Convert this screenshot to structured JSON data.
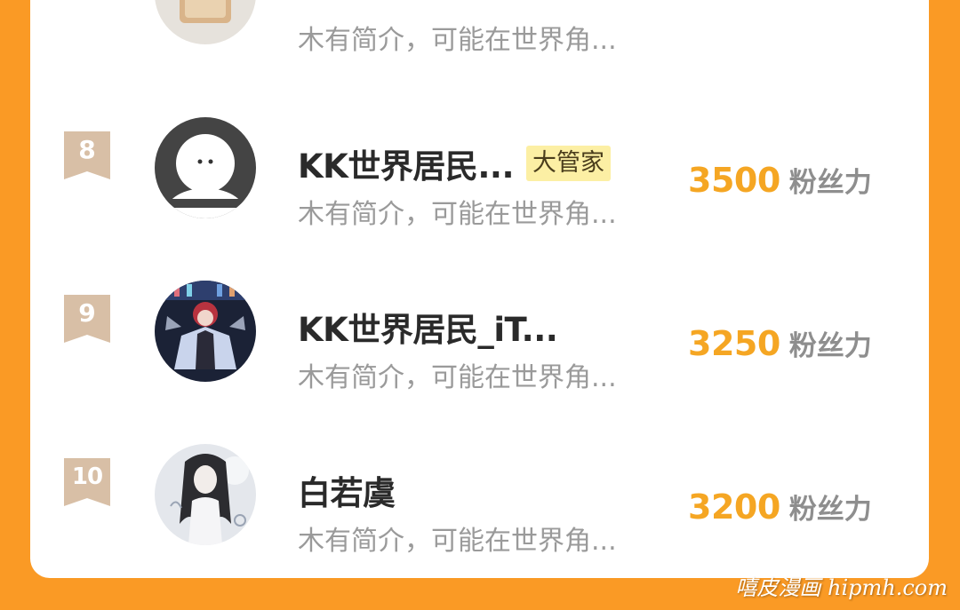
{
  "list": [
    {
      "rank": "",
      "name": "",
      "badge": "",
      "bio": "木有简介，可能在世界角...",
      "score": "",
      "unit": "",
      "avatar": "toast-avatar-icon"
    },
    {
      "rank": "8",
      "name": "KK世界居民...",
      "badge": "大管家",
      "bio": "木有简介，可能在世界角...",
      "score": "3500",
      "unit": "粉丝力",
      "avatar": "default-user-avatar-icon"
    },
    {
      "rank": "9",
      "name": "KK世界居民_iT...",
      "badge": "",
      "bio": "木有简介，可能在世界角...",
      "score": "3250",
      "unit": "粉丝力",
      "avatar": "anime-character-avatar"
    },
    {
      "rank": "10",
      "name": "白若虞",
      "badge": "",
      "bio": "木有简介，可能在世界角...",
      "score": "3200",
      "unit": "粉丝力",
      "avatar": "anime-girl-avatar"
    }
  ],
  "watermark": "嘻皮漫画 hipmh.com",
  "colors": {
    "background": "#FA9A25",
    "score": "#F5A623",
    "rank_ribbon": "#D8BFA6",
    "badge": "#FCEFA4"
  }
}
